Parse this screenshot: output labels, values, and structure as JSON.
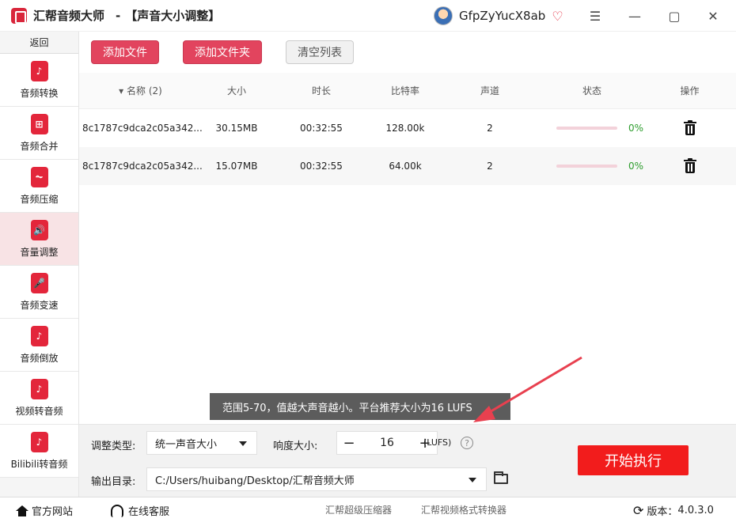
{
  "window": {
    "app_title": "汇帮音频大师",
    "separator": "-",
    "page_title": "【声音大小调整】",
    "username": "GfpZyYucX8ab",
    "controls": {
      "menu": "☰",
      "minimize": "—",
      "maximize": "▢",
      "close": "✕"
    }
  },
  "sidebar": {
    "back": "返回",
    "items": [
      {
        "label": "音频转换",
        "icon": "♪"
      },
      {
        "label": "音频合并",
        "icon": "⊞"
      },
      {
        "label": "音频压缩",
        "icon": "⏦"
      },
      {
        "label": "音量调整",
        "icon": "🔊",
        "active": true
      },
      {
        "label": "音频变速",
        "icon": "🎤"
      },
      {
        "label": "音频倒放",
        "icon": "♪"
      },
      {
        "label": "视频转音频",
        "icon": "♪"
      },
      {
        "label": "Bilibili转音频",
        "icon": "♪"
      }
    ]
  },
  "toolbar": {
    "add_file": "添加文件",
    "add_folder": "添加文件夹",
    "clear_list": "清空列表"
  },
  "table": {
    "headers": {
      "name": "▾ 名称 (2)",
      "size": "大小",
      "duration": "时长",
      "bitrate": "比特率",
      "channels": "声道",
      "status": "状态",
      "action": "操作"
    },
    "rows": [
      {
        "name": "8c1787c9dca2c05a342...",
        "size": "30.15MB",
        "duration": "00:32:55",
        "bitrate": "128.00k",
        "channels": "2",
        "progress": 0,
        "percent": "0%"
      },
      {
        "name": "8c1787c9dca2c05a342...",
        "size": "15.07MB",
        "duration": "00:32:55",
        "bitrate": "64.00k",
        "channels": "2",
        "progress": 0,
        "percent": "0%"
      }
    ]
  },
  "tooltip": "范围5-70，值越大声音越小。平台推荐大小为16 LUFS",
  "settings": {
    "adjust_type_label": "调整类型:",
    "adjust_type_value": "统一声音大小",
    "loudness_label": "响度大小:",
    "loudness_value": "16",
    "unit": "(LUFS)",
    "minus": "−",
    "plus": "+",
    "help": "?",
    "output_label": "输出目录:",
    "output_path": "C:/Users/huibang/Desktop/汇帮音频大师",
    "start": "开始执行"
  },
  "statusbar": {
    "website": "官方网站",
    "support": "在线客服",
    "link1": "汇帮超级压缩器",
    "link2": "汇帮视频格式转换器",
    "version_label": "版本：",
    "version": "4.0.3.0"
  },
  "colors": {
    "accent": "#e2445e",
    "start": "#f21c1c",
    "active_bg": "#f8e3e5",
    "percent": "#2e9d2e"
  }
}
